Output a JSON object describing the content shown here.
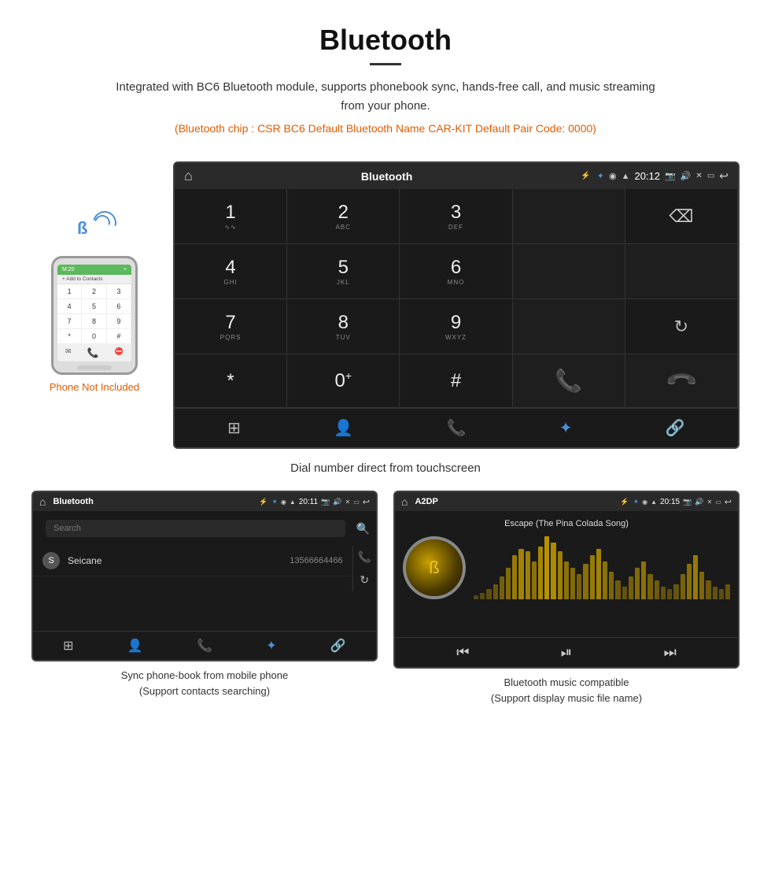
{
  "header": {
    "title": "Bluetooth",
    "description": "Integrated with BC6 Bluetooth module, supports phonebook sync, hands-free call, and music streaming from your phone.",
    "spec_line": "(Bluetooth chip : CSR BC6    Default Bluetooth Name CAR-KIT     Default Pair Code: 0000)"
  },
  "phone_label": "Phone Not Included",
  "main_screen": {
    "status_bar": {
      "title": "Bluetooth",
      "usb_icon": "⚡",
      "bt_icon": "✦",
      "location_icon": "◉",
      "wifi_icon": "▲",
      "time": "20:12",
      "home_icon": "⌂",
      "back_icon": "↩"
    },
    "dial_keys": [
      {
        "number": "1",
        "sub": "∿∿",
        "col": 1
      },
      {
        "number": "2",
        "sub": "ABC",
        "col": 2
      },
      {
        "number": "3",
        "sub": "DEF",
        "col": 3
      },
      {
        "number": "",
        "sub": "",
        "col": 4
      },
      {
        "number": "⌫",
        "sub": "",
        "col": 5
      },
      {
        "number": "4",
        "sub": "GHI",
        "col": 1
      },
      {
        "number": "5",
        "sub": "JKL",
        "col": 2
      },
      {
        "number": "6",
        "sub": "MNO",
        "col": 3
      },
      {
        "number": "",
        "sub": "",
        "col": 4
      },
      {
        "number": "",
        "sub": "",
        "col": 5
      },
      {
        "number": "7",
        "sub": "PQRS",
        "col": 1
      },
      {
        "number": "8",
        "sub": "TUV",
        "col": 2
      },
      {
        "number": "9",
        "sub": "WXYZ",
        "col": 3
      },
      {
        "number": "",
        "sub": "",
        "col": 4
      },
      {
        "number": "↻",
        "sub": "",
        "col": 5
      },
      {
        "number": "*",
        "sub": "",
        "col": 1
      },
      {
        "number": "0⁺",
        "sub": "",
        "col": 2
      },
      {
        "number": "#",
        "sub": "",
        "col": 3
      },
      {
        "number": "📞",
        "sub": "",
        "col": 4
      },
      {
        "number": "📞",
        "sub": "",
        "col": 5
      }
    ],
    "toolbar_icons": [
      "⊞",
      "👤",
      "📞",
      "✦",
      "🔗"
    ],
    "caption": "Dial number direct from touchscreen"
  },
  "phonebook_screen": {
    "status_bar": {
      "home_icon": "⌂",
      "title": "Bluetooth",
      "usb_icon": "⚡",
      "bt_icon": "✦",
      "time": "20:11",
      "back_icon": "↩"
    },
    "search_placeholder": "Search",
    "contacts": [
      {
        "letter": "S",
        "name": "Seicane",
        "number": "13566664466"
      }
    ],
    "caption_line1": "Sync phone-book from mobile phone",
    "caption_line2": "(Support contacts searching)"
  },
  "music_screen": {
    "status_bar": {
      "home_icon": "⌂",
      "title": "A2DP",
      "usb_icon": "⚡",
      "bt_icon": "✦",
      "time": "20:15",
      "back_icon": "↩"
    },
    "song_title": "Escape (The Pina Colada Song)",
    "eq_bars": [
      3,
      5,
      8,
      12,
      18,
      25,
      35,
      40,
      38,
      30,
      42,
      50,
      45,
      38,
      30,
      25,
      20,
      28,
      35,
      40,
      30,
      22,
      15,
      10,
      18,
      25,
      30,
      20,
      15,
      10,
      8,
      12,
      20,
      28,
      35,
      22,
      15,
      10,
      8,
      12
    ],
    "controls": [
      "⏮",
      "⏯",
      "⏭"
    ],
    "caption_line1": "Bluetooth music compatible",
    "caption_line2": "(Support display music file name)"
  }
}
